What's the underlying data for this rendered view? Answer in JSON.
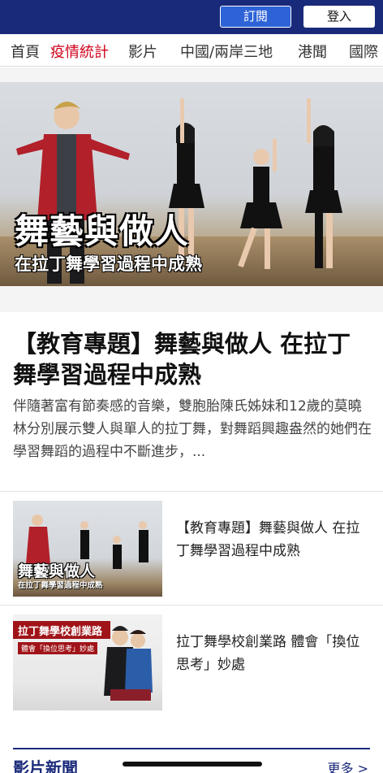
{
  "topbar": {
    "subscribe_label": "訂閱",
    "login_label": "登入",
    "bg_color": "#1a2a7a",
    "accent_color": "#2e63d8"
  },
  "nav": {
    "items": [
      {
        "label": "首頁",
        "active": false
      },
      {
        "label": "疫情統計",
        "active": true
      },
      {
        "label": "影片",
        "active": false
      },
      {
        "label": "中國/兩岸三地",
        "active": false
      },
      {
        "label": "港聞",
        "active": false
      },
      {
        "label": "國際",
        "active": false
      }
    ],
    "active_color": "#d0021b"
  },
  "hero": {
    "overlay_title": "舞藝與做人",
    "overlay_subtitle": "在拉丁舞學習過程中成熟"
  },
  "article": {
    "headline": "【教育專題】舞藝與做人 在拉丁舞學習過程中成熟",
    "summary": "伴隨著富有節奏感的音樂，雙胞胎陳氏姊妹和12歲的莫曉林分別展示雙人與單人的拉丁舞，對舞蹈興趣盎然的她們在學習舞蹈的過程中不斷進步，..."
  },
  "related": [
    {
      "title": "【教育專題】舞藝與做人 在拉丁舞學習過程中成熟",
      "thumb_title": "舞藝與做人",
      "thumb_sub": "在拉丁舞學習過程中成熟"
    },
    {
      "title": "拉丁舞學校創業路 體會「換位思考」妙處",
      "thumb_title": "拉丁舞學校創業路",
      "thumb_sub": "體會「換位思考」妙處"
    }
  ],
  "section": {
    "title": "影片新聞",
    "more_label": "更多 >"
  }
}
